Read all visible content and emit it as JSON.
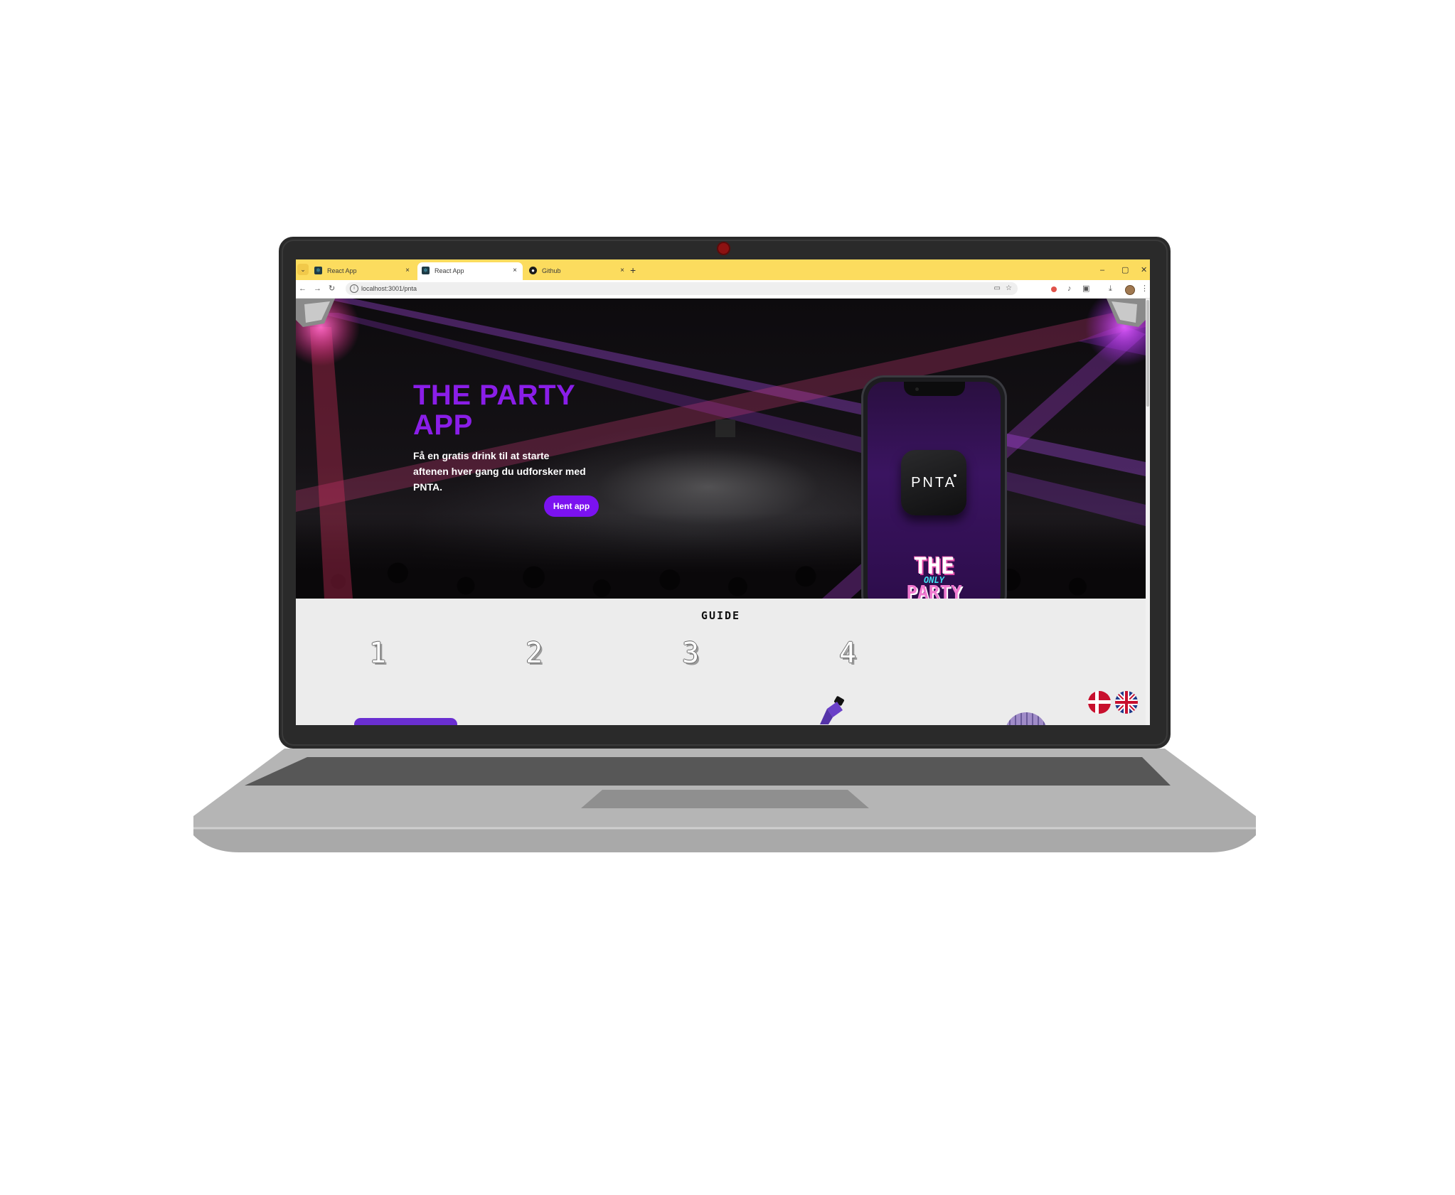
{
  "browser": {
    "tabs": [
      {
        "title": "React App",
        "icon": "react-icon",
        "active": false
      },
      {
        "title": "React App",
        "icon": "react-icon",
        "active": true
      },
      {
        "title": "Github",
        "icon": "github-icon",
        "active": false
      }
    ],
    "new_tab_label": "+",
    "url": "localhost:3001/pnta",
    "tab_color": "#fcdc5e"
  },
  "hero": {
    "title": "THE PARTY APP",
    "text": "Få en gratis drink til at starte aftenen hver gang du udforsker med PNTA.",
    "cta_label": "Hent app",
    "accent_color": "#8a1ee8",
    "cta_color": "#7b12f0"
  },
  "phone": {
    "app_name": "PNTA",
    "promo_top": "THE",
    "promo_mid": "ONLY",
    "promo_bottom": "PARTY"
  },
  "guide": {
    "title": "GUIDE",
    "steps": [
      "1",
      "2",
      "3",
      "4"
    ]
  },
  "language": {
    "options": [
      "danish-flag",
      "uk-flag"
    ]
  }
}
